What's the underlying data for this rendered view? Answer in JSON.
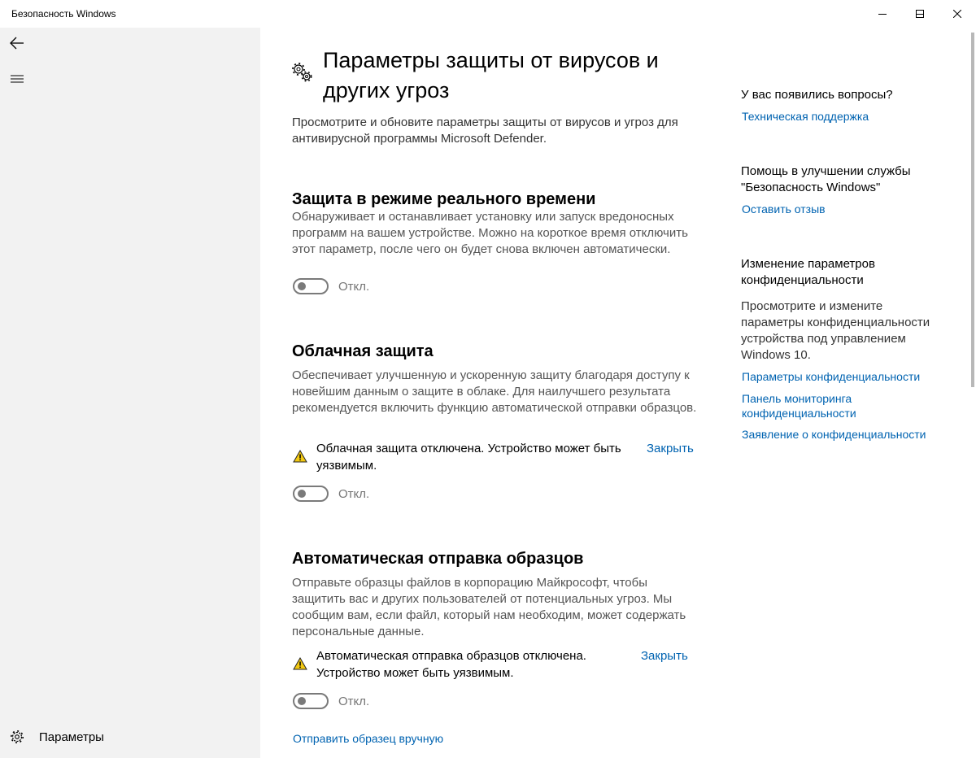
{
  "window": {
    "title": "Безопасность Windows"
  },
  "nav": {
    "settings_label": "Параметры"
  },
  "page": {
    "title": "Параметры защиты от вирусов и других угроз",
    "description": "Просмотрите и обновите параметры защиты от вирусов и угроз для антивирусной программы Microsoft Defender."
  },
  "sections": {
    "realtime": {
      "title": "Защита в режиме реального времени",
      "description": "Обнаруживает и останавливает установку или запуск вредоносных программ на вашем устройстве. Можно на короткое время отключить этот параметр, после чего он будет снова включен автоматически.",
      "toggle_state": "Откл."
    },
    "cloud": {
      "title": "Облачная защита",
      "description": "Обеспечивает улучшенную и ускоренную защиту благодаря доступу к новейшим данным о защите в облаке. Для наилучшего результата рекомендуется включить функцию автоматической отправки образцов.",
      "warning": "Облачная защита отключена. Устройство может быть уязвимым.",
      "dismiss": "Закрыть",
      "toggle_state": "Откл."
    },
    "samples": {
      "title": "Автоматическая отправка образцов",
      "description": "Отправьте образцы файлов в корпорацию Майкрософт, чтобы защитить вас и других пользователей от потенциальных угроз. Мы сообщим вам, если файл, который нам необходим, может содержать персональные данные.",
      "warning": "Автоматическая отправка образцов отключена. Устройство может быть уязвимым.",
      "dismiss": "Закрыть",
      "toggle_state": "Откл.",
      "manual_link": "Отправить образец вручную"
    }
  },
  "side": {
    "questions_heading": "У вас появились вопросы?",
    "support_link": "Техническая поддержка",
    "improve_heading": "Помощь в улучшении службы \"Безопасность Windows\"",
    "feedback_link": "Оставить отзыв",
    "privacy_heading": "Изменение параметров конфиденциальности",
    "privacy_text": "Просмотрите и измените параметры конфиденциальности устройства под управлением Windows 10.",
    "privacy_settings_link": "Параметры конфиденциальности",
    "privacy_dashboard_link": "Панель мониторинга конфиденциальности",
    "privacy_statement_link": "Заявление о конфиденциальности"
  },
  "colors": {
    "accent": "#0063b1",
    "nav_bg": "#f2f2f2",
    "warning": "#f2c811"
  }
}
